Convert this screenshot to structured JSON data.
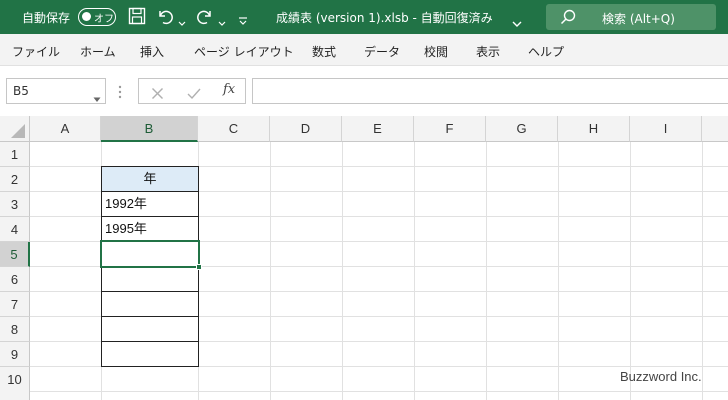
{
  "titlebar": {
    "autosave_label": "自動保存",
    "autosave_state": "オフ",
    "document_title": "成績表 (version 1).xlsb  -  自動回復済み",
    "search_placeholder": "検索 (Alt+Q)",
    "accent_color": "#217346"
  },
  "menu": {
    "items": [
      "ファイル",
      "ホーム",
      "挿入",
      "ページ レイアウト",
      "数式",
      "データ",
      "校閲",
      "表示",
      "ヘルプ"
    ]
  },
  "formula_bar": {
    "name_box": "B5",
    "fx_label": "fx",
    "cancel_icon": "cancel-icon",
    "enter_icon": "check-icon",
    "formula_value": ""
  },
  "sheet": {
    "columns": [
      "A",
      "B",
      "C",
      "D",
      "E",
      "F",
      "G",
      "H",
      "I"
    ],
    "rows": [
      "1",
      "2",
      "3",
      "4",
      "5",
      "6",
      "7",
      "8",
      "9",
      "10"
    ],
    "selected_column": "B",
    "selected_row": "5",
    "cells": {
      "B2": "年",
      "B3": "1992年",
      "B4": "1995年"
    }
  },
  "watermark": "Buzzword Inc."
}
